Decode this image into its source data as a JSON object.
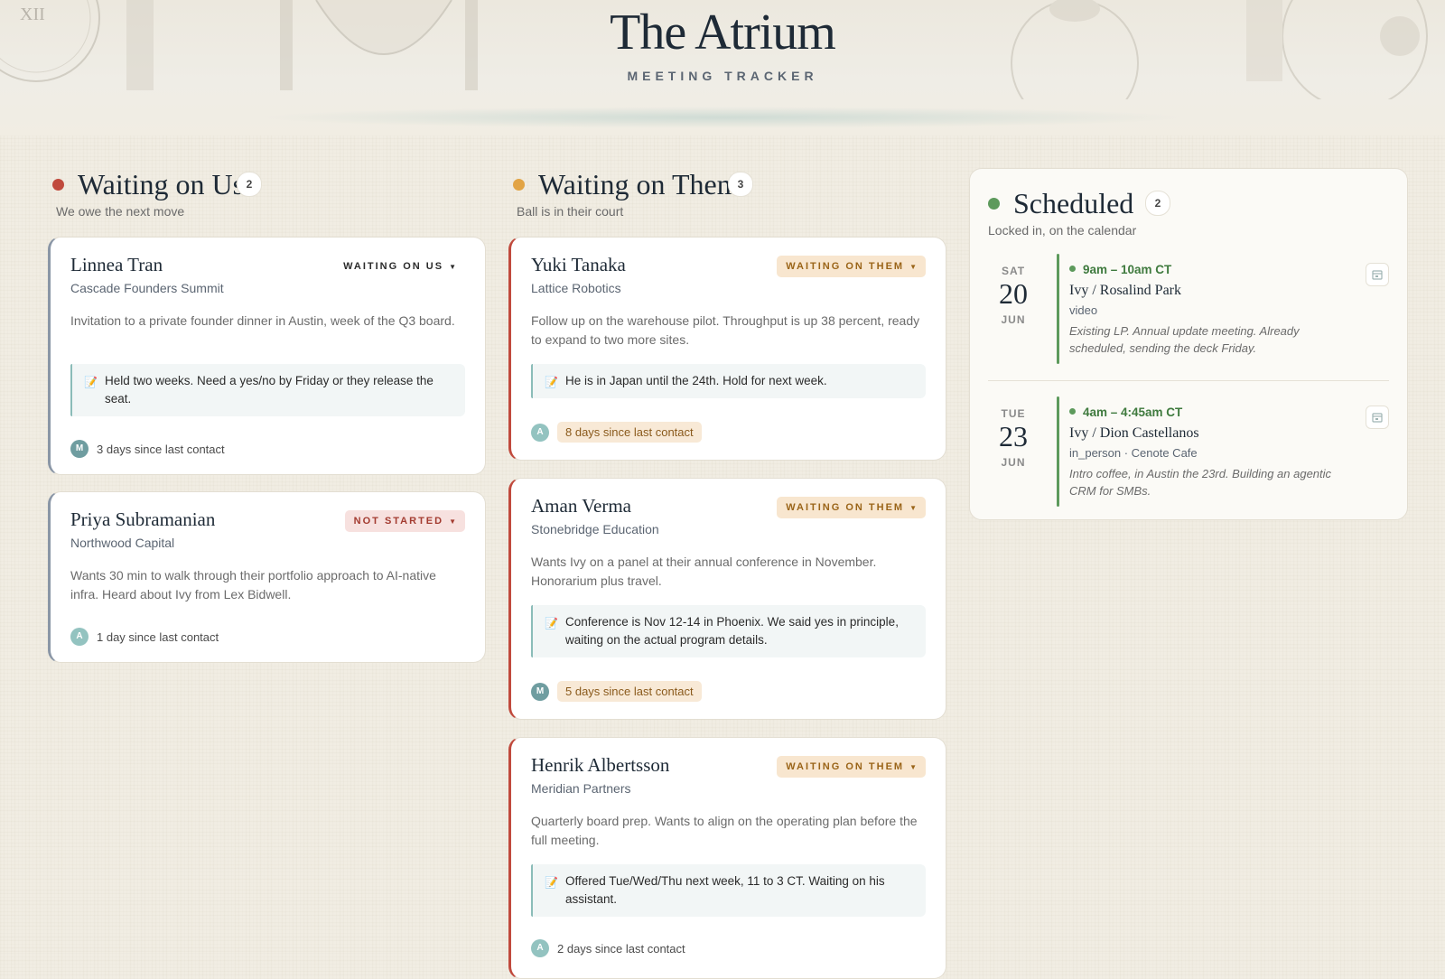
{
  "header": {
    "title": "The Atrium",
    "subtitle": "MEETING TRACKER"
  },
  "colors": {
    "red": "#c04a3d",
    "amber": "#e2a445",
    "green": "#5d9a5c"
  },
  "columns": {
    "us": {
      "title": "Waiting on Us",
      "count": "2",
      "desc": "We owe the next move",
      "cards": [
        {
          "name": "Linnea Tran",
          "company": "Cascade Founders Summit",
          "status": "WAITING ON US",
          "body": "Invitation to a private founder dinner in Austin, week of the Q3 board.",
          "note": "Held two weeks. Need a yes/no by Friday or they release the seat.",
          "avatar": "M",
          "since": "3 days since last contact"
        },
        {
          "name": "Priya Subramanian",
          "company": "Northwood Capital",
          "status": "NOT STARTED",
          "body": "Wants 30 min to walk through their portfolio approach to AI-native infra. Heard about Ivy from Lex Bidwell.",
          "avatar": "A",
          "since": "1 day since last contact"
        }
      ]
    },
    "them": {
      "title": "Waiting on Them",
      "count": "3",
      "desc": "Ball is in their court",
      "cards": [
        {
          "name": "Yuki Tanaka",
          "company": "Lattice Robotics",
          "status": "WAITING ON THEM",
          "body": "Follow up on the warehouse pilot. Throughput is up 38 percent, ready to expand to two more sites.",
          "note": "He is in Japan until the 24th. Hold for next week.",
          "avatar": "A",
          "since": "8 days since last contact"
        },
        {
          "name": "Aman Verma",
          "company": "Stonebridge Education",
          "status": "WAITING ON THEM",
          "body": "Wants Ivy on a panel at their annual conference in November. Honorarium plus travel.",
          "note": "Conference is Nov 12-14 in Phoenix. We said yes in principle, waiting on the actual program details.",
          "avatar": "M",
          "since": "5 days since last contact"
        },
        {
          "name": "Henrik Albertsson",
          "company": "Meridian Partners",
          "status": "WAITING ON THEM",
          "body": "Quarterly board prep. Wants to align on the operating plan before the full meeting.",
          "note": "Offered Tue/Wed/Thu next week, 11 to 3 CT. Waiting on his assistant.",
          "avatar": "A",
          "since": "2 days since last contact"
        }
      ]
    },
    "scheduled": {
      "title": "Scheduled",
      "count": "2",
      "desc": "Locked in, on the calendar",
      "events": [
        {
          "dow": "SAT",
          "day": "20",
          "month": "JUN",
          "time": "9am – 10am CT",
          "who": "Ivy / Rosalind Park",
          "mode": "video",
          "note": "Existing LP. Annual update meeting. Already scheduled, sending the deck Friday."
        },
        {
          "dow": "TUE",
          "day": "23",
          "month": "JUN",
          "time": "4am – 4:45am CT",
          "who": "Ivy / Dion Castellanos",
          "mode": "in_person · Cenote Cafe",
          "note": "Intro coffee, in Austin the 23rd. Building an agentic CRM for SMBs."
        }
      ]
    }
  },
  "icons": {
    "note": "memo-icon",
    "calendar": "calendar-icon",
    "dropdown": "caret-down-icon"
  }
}
